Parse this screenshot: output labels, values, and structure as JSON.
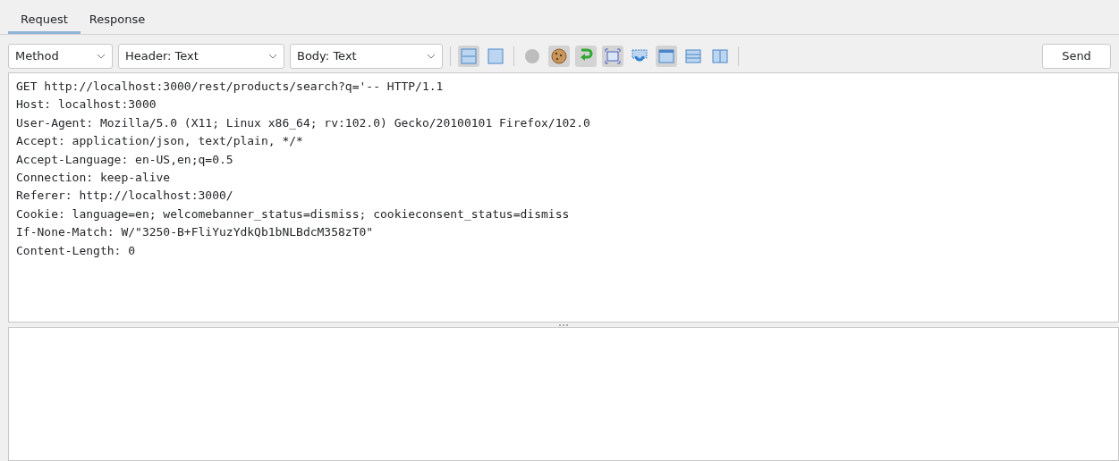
{
  "tabs": [
    {
      "label": "Request",
      "selected": true
    },
    {
      "label": "Response",
      "selected": false
    }
  ],
  "toolbar": {
    "dropdowns": [
      "Method",
      "Header: Text",
      "Body: Text"
    ],
    "toggle_groups": [
      [
        {
          "kind": "split-horizontal",
          "on": true
        },
        {
          "kind": "single-pane",
          "on": false
        }
      ],
      [
        {
          "kind": "circle",
          "on": false
        },
        {
          "kind": "cookie",
          "on": true
        },
        {
          "kind": "wrap",
          "on": true
        },
        {
          "kind": "frame",
          "on": true
        },
        {
          "kind": "refresh",
          "on": false
        },
        {
          "kind": "window",
          "on": true
        },
        {
          "kind": "rows",
          "on": false
        },
        {
          "kind": "columns",
          "on": false
        }
      ]
    ],
    "send_button": "Send"
  },
  "request_lines": [
    "GET http://localhost:3000/rest/products/search?q='-- HTTP/1.1",
    "Host: localhost:3000",
    "User-Agent: Mozilla/5.0 (X11; Linux x86_64; rv:102.0) Gecko/20100101 Firefox/102.0",
    "Accept: application/json, text/plain, */*",
    "Accept-Language: en-US,en;q=0.5",
    "Connection: keep-alive",
    "Referer: http://localhost:3000/",
    "Cookie: language=en; welcomebanner_status=dismiss; cookieconsent_status=dismiss",
    "If-None-Match: W/\"3250-B+FliYuzYdkQb1bNLBdcM358zT0\"",
    "Content-Length: 0"
  ]
}
